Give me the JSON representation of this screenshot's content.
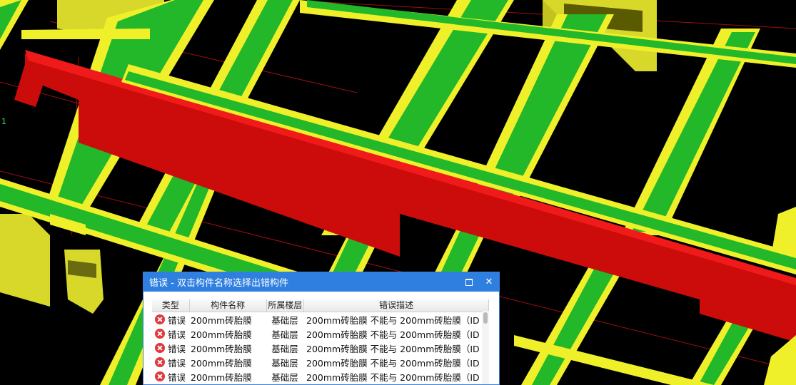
{
  "axis_label": "1",
  "dialog": {
    "title": "错误 - 双击构件名称选择出错构件",
    "columns": {
      "type": "类型",
      "name": "构件名称",
      "floor": "所属楼层",
      "description": "错误描述"
    },
    "rows": [
      {
        "type": "错误",
        "name": "200mm砖胎膜",
        "floor": "基础层",
        "description": "200mm砖胎膜 不能与 200mm砖胎膜（ID ..."
      },
      {
        "type": "错误",
        "name": "200mm砖胎膜",
        "floor": "基础层",
        "description": "200mm砖胎膜 不能与 200mm砖胎膜（ID ..."
      },
      {
        "type": "错误",
        "name": "200mm砖胎膜",
        "floor": "基础层",
        "description": "200mm砖胎膜 不能与 200mm砖胎膜（ID ..."
      },
      {
        "type": "错误",
        "name": "200mm砖胎膜",
        "floor": "基础层",
        "description": "200mm砖胎膜 不能与 200mm砖胎膜（ID ..."
      },
      {
        "type": "错误",
        "name": "200mm砖胎膜",
        "floor": "基础层",
        "description": "200mm砖胎膜 不能与 200mm砖胎膜（ID ..."
      }
    ]
  },
  "colors": {
    "beam_green": "#22b82a",
    "beam_yellow": "#f0f02a",
    "wall_red": "#d80d0d",
    "title_blue": "#2f7fe0"
  }
}
